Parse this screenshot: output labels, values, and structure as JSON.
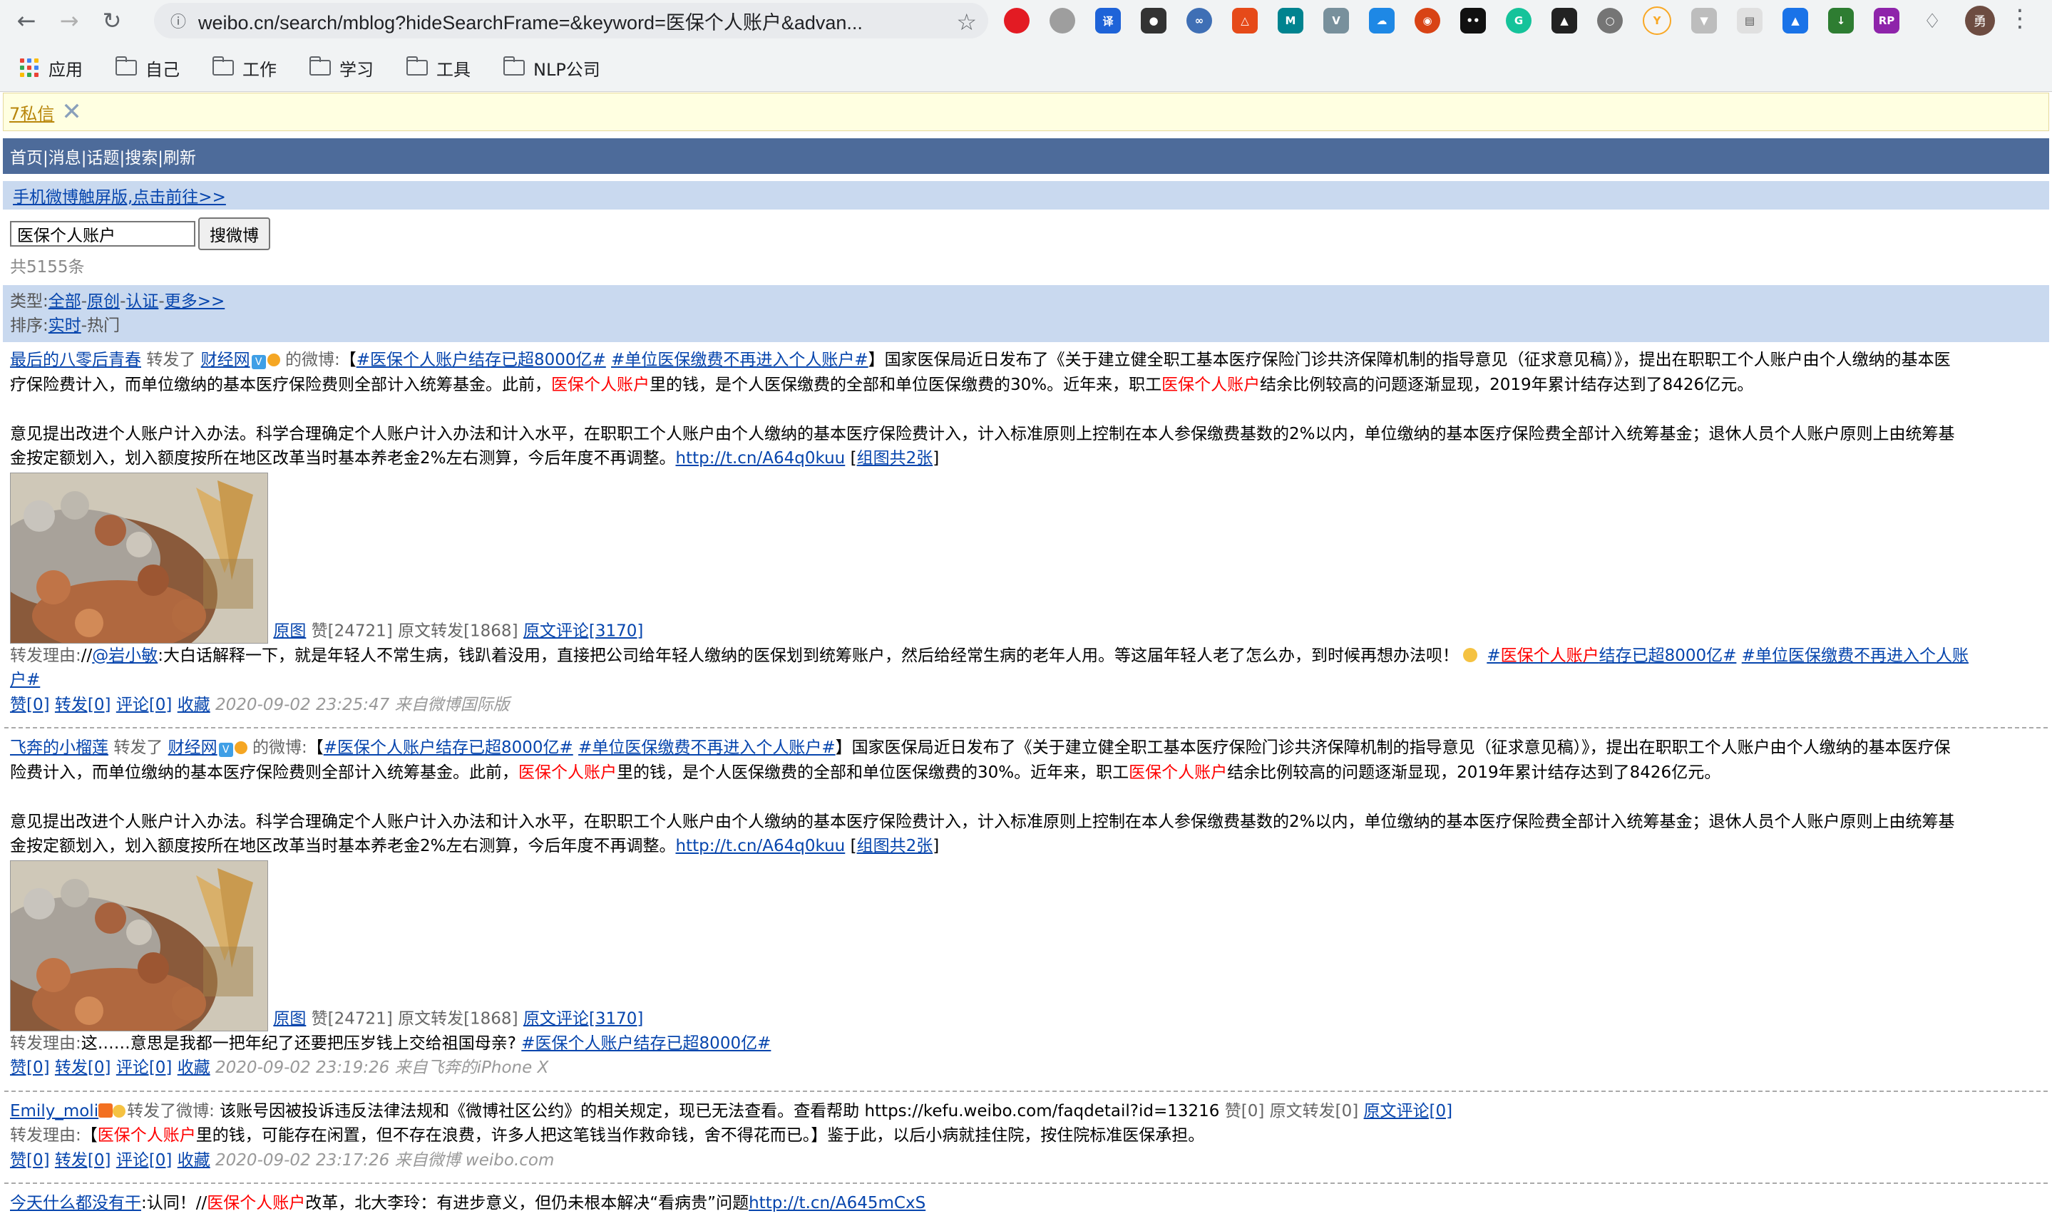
{
  "browser": {
    "url": "weibo.cn/search/mblog?hideSearchFrame=&keyword=医保个人账户&advan...",
    "profile_initial": "勇",
    "bookmarks": [
      "应用",
      "自己",
      "工作",
      "学习",
      "工具",
      "NLP公司"
    ]
  },
  "notice": {
    "messages": "7私信"
  },
  "nav": {
    "links": "首页|消息|话题|搜索|刷新"
  },
  "touch_link": "手机微博触屏版,点击前往>>",
  "search": {
    "value": "医保个人账户",
    "button": "搜微博",
    "count": "共5155条"
  },
  "filter": {
    "type_label": "类型:",
    "type_all": "全部",
    "type_orig": "原创",
    "type_verified": "认证",
    "type_more": "更多>>",
    "sort_label": "排序:",
    "sort_realtime": "实时",
    "sort_hot": "热门"
  },
  "posts": [
    {
      "user": "最后的八零后青春",
      "forwarded": "转发了",
      "source_user": "财经网",
      "of_weibo": "的微博:",
      "hashtag1": "#医保个人账户结存已超8000亿#",
      "hashtag2": "#单位医保缴费不再进入个人账户#",
      "text_a": "】国家医保局近日发布了《关于建立健全职工基本医疗保险门诊共济保障机制的指导意见（征求意见稿）》，提出在职职工个人账户由个人缴纳的基本医",
      "text_b": "疗保险费计入，而单位缴纳的基本医疗保险费则全部计入统筹基金。此前，",
      "kw": "医保个人账户",
      "text_c": "里的钱，是个人医保缴费的全部和单位医保缴费的30%。近年来，职工",
      "text_d": "结余比例较高的问题逐渐显现，2019年累计结存达到了8426亿元。",
      "text_e": "意见提出改进个人账户计入办法。科学合理确定个人账户计入办法和计入水平，在职职工个人账户由个人缴纳的基本医疗保险费计入，计入标准原则上控制在本人参保缴费基数的2%以内，单位缴纳的基本医疗保险费全部计入统筹基金；退休人员个人账户原则上由统筹基",
      "text_f": "金按定额划入，划入额度按所在地区改革当时基本养老金2%左右测算，今后年度不再调整。",
      "short_url": "http://t.cn/A64q0kuu",
      "group_pics": "组图共2张",
      "orig_pic": "原图",
      "likes": "赞[24721]",
      "orig_fwd": "原文转发[1868]",
      "orig_cmt": "原文评论[3170]",
      "reason_label": "转发理由:",
      "reason_a": "//",
      "mention": "@岩小敏",
      "reason_b": ":大白话解释一下，就是年轻人不常生病，钱趴着没用，直接把公司给年轻人缴纳的医保划到统筹账户，然后给经常生病的老年人用。等这届年轻人老了怎么办，到时候再想办法呗！",
      "rh1_a": "#",
      "rh1_b": "结存已超8000亿#",
      "rh2": "#单位医保缴费不再进入个人账",
      "rh2_tail": "户#",
      "like": "赞[0]",
      "fwd": "转发[0]",
      "cmt": "评论[0]",
      "fav": "收藏",
      "time": "2020-09-02 23:25:47 来自微博国际版"
    },
    {
      "user": "飞奔的小榴莲",
      "forwarded": "转发了",
      "source_user": "财经网",
      "of_weibo": "的微博:",
      "hashtag1": "#医保个人账户结存已超8000亿#",
      "hashtag2": "#单位医保缴费不再进入个人账户#",
      "text_a": "】国家医保局近日发布了《关于建立健全职工基本医疗保险门诊共济保障机制的指导意见（征求意见稿）》，提出在职职工个人账户由个人缴纳的基本医疗保",
      "text_b": "险费计入，而单位缴纳的基本医疗保险费则全部计入统筹基金。此前，",
      "kw": "医保个人账户",
      "text_c": "里的钱，是个人医保缴费的全部和单位医保缴费的30%。近年来，职工",
      "text_d": "结余比例较高的问题逐渐显现，2019年累计结存达到了8426亿元。",
      "text_e": "意见提出改进个人账户计入办法。科学合理确定个人账户计入办法和计入水平，在职职工个人账户由个人缴纳的基本医疗保险费计入，计入标准原则上控制在本人参保缴费基数的2%以内，单位缴纳的基本医疗保险费全部计入统筹基金；退休人员个人账户原则上由统筹基",
      "text_f": "金按定额划入，划入额度按所在地区改革当时基本养老金2%左右测算，今后年度不再调整。",
      "short_url": "http://t.cn/A64q0kuu",
      "group_pics": "组图共2张",
      "orig_pic": "原图",
      "likes": "赞[24721]",
      "orig_fwd": "原文转发[1868]",
      "orig_cmt": "原文评论[3170]",
      "reason_label": "转发理由:",
      "reason_a": "这……意思是我都一把年纪了还要把压岁钱上交给祖国母亲?",
      "reason_hashtag": "#医保个人账户结存已超8000亿#",
      "like": "赞[0]",
      "fwd": "转发[0]",
      "cmt": "评论[0]",
      "fav": "收藏",
      "time": "2020-09-02 23:19:26 来自飞奔的iPhone X"
    },
    {
      "user": "Emily_moli",
      "forwarded": "转发了微博:",
      "text": "该账号因被投诉违反法律法规和《微博社区公约》的相关规定，现已无法查看。查看帮助 https://kefu.weibo.com/faqdetail?id=13216",
      "orig_like": "赞[0]",
      "orig_fwd": "原文转发[0]",
      "orig_cmt": "原文评论[0]",
      "reason_label": "转发理由:",
      "reason_a": "【",
      "kw": "医保个人账户",
      "reason_b": "里的钱，可能存在闲置，但不存在浪费，许多人把这笔钱当作救命钱，舍不得花而已。】鉴于此，以后小病就挂住院，按住院标准医保承担。",
      "like": "赞[0]",
      "fwd": "转发[0]",
      "cmt": "评论[0]",
      "fav": "收藏",
      "time": "2020-09-02 23:17:26 来自微博 weibo.com"
    },
    {
      "user": "今天什么都没有干",
      "text_a": ":认同！//",
      "kw": "医保个人账户",
      "text_b": "改革，北大李玲：有进步意义，但仍未根本解决“看病贵”问题",
      "short_url": "http://t.cn/A645mCxS"
    }
  ]
}
